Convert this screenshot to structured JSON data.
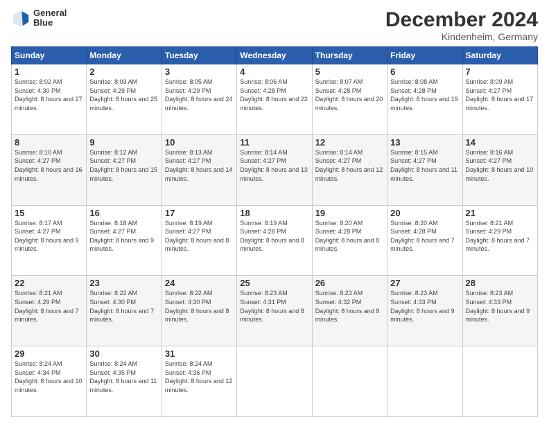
{
  "header": {
    "title": "December 2024",
    "subtitle": "Kindenheim, Germany",
    "logo_line1": "General",
    "logo_line2": "Blue"
  },
  "days_of_week": [
    "Sunday",
    "Monday",
    "Tuesday",
    "Wednesday",
    "Thursday",
    "Friday",
    "Saturday"
  ],
  "weeks": [
    [
      {
        "day": 1,
        "sunrise": "8:02 AM",
        "sunset": "4:30 PM",
        "daylight": "8 hours and 27 minutes."
      },
      {
        "day": 2,
        "sunrise": "8:03 AM",
        "sunset": "4:29 PM",
        "daylight": "8 hours and 25 minutes."
      },
      {
        "day": 3,
        "sunrise": "8:05 AM",
        "sunset": "4:29 PM",
        "daylight": "8 hours and 24 minutes."
      },
      {
        "day": 4,
        "sunrise": "8:06 AM",
        "sunset": "4:28 PM",
        "daylight": "8 hours and 22 minutes."
      },
      {
        "day": 5,
        "sunrise": "8:07 AM",
        "sunset": "4:28 PM",
        "daylight": "8 hours and 20 minutes."
      },
      {
        "day": 6,
        "sunrise": "8:08 AM",
        "sunset": "4:28 PM",
        "daylight": "8 hours and 19 minutes."
      },
      {
        "day": 7,
        "sunrise": "8:09 AM",
        "sunset": "4:27 PM",
        "daylight": "8 hours and 17 minutes."
      }
    ],
    [
      {
        "day": 8,
        "sunrise": "8:10 AM",
        "sunset": "4:27 PM",
        "daylight": "8 hours and 16 minutes."
      },
      {
        "day": 9,
        "sunrise": "8:12 AM",
        "sunset": "4:27 PM",
        "daylight": "8 hours and 15 minutes."
      },
      {
        "day": 10,
        "sunrise": "8:13 AM",
        "sunset": "4:27 PM",
        "daylight": "8 hours and 14 minutes."
      },
      {
        "day": 11,
        "sunrise": "8:14 AM",
        "sunset": "4:27 PM",
        "daylight": "8 hours and 13 minutes."
      },
      {
        "day": 12,
        "sunrise": "8:14 AM",
        "sunset": "4:27 PM",
        "daylight": "8 hours and 12 minutes."
      },
      {
        "day": 13,
        "sunrise": "8:15 AM",
        "sunset": "4:27 PM",
        "daylight": "8 hours and 11 minutes."
      },
      {
        "day": 14,
        "sunrise": "8:16 AM",
        "sunset": "4:27 PM",
        "daylight": "8 hours and 10 minutes."
      }
    ],
    [
      {
        "day": 15,
        "sunrise": "8:17 AM",
        "sunset": "4:27 PM",
        "daylight": "8 hours and 9 minutes."
      },
      {
        "day": 16,
        "sunrise": "8:18 AM",
        "sunset": "4:27 PM",
        "daylight": "8 hours and 9 minutes."
      },
      {
        "day": 17,
        "sunrise": "8:19 AM",
        "sunset": "4:27 PM",
        "daylight": "8 hours and 8 minutes."
      },
      {
        "day": 18,
        "sunrise": "8:19 AM",
        "sunset": "4:28 PM",
        "daylight": "8 hours and 8 minutes."
      },
      {
        "day": 19,
        "sunrise": "8:20 AM",
        "sunset": "4:28 PM",
        "daylight": "8 hours and 8 minutes."
      },
      {
        "day": 20,
        "sunrise": "8:20 AM",
        "sunset": "4:28 PM",
        "daylight": "8 hours and 7 minutes."
      },
      {
        "day": 21,
        "sunrise": "8:21 AM",
        "sunset": "4:29 PM",
        "daylight": "8 hours and 7 minutes."
      }
    ],
    [
      {
        "day": 22,
        "sunrise": "8:21 AM",
        "sunset": "4:29 PM",
        "daylight": "8 hours and 7 minutes."
      },
      {
        "day": 23,
        "sunrise": "8:22 AM",
        "sunset": "4:30 PM",
        "daylight": "8 hours and 7 minutes."
      },
      {
        "day": 24,
        "sunrise": "8:22 AM",
        "sunset": "4:30 PM",
        "daylight": "8 hours and 8 minutes."
      },
      {
        "day": 25,
        "sunrise": "8:23 AM",
        "sunset": "4:31 PM",
        "daylight": "8 hours and 8 minutes."
      },
      {
        "day": 26,
        "sunrise": "8:23 AM",
        "sunset": "4:32 PM",
        "daylight": "8 hours and 8 minutes."
      },
      {
        "day": 27,
        "sunrise": "8:23 AM",
        "sunset": "4:33 PM",
        "daylight": "8 hours and 9 minutes."
      },
      {
        "day": 28,
        "sunrise": "8:23 AM",
        "sunset": "4:33 PM",
        "daylight": "8 hours and 9 minutes."
      }
    ],
    [
      {
        "day": 29,
        "sunrise": "8:24 AM",
        "sunset": "4:34 PM",
        "daylight": "8 hours and 10 minutes."
      },
      {
        "day": 30,
        "sunrise": "8:24 AM",
        "sunset": "4:35 PM",
        "daylight": "8 hours and 11 minutes."
      },
      {
        "day": 31,
        "sunrise": "8:24 AM",
        "sunset": "4:36 PM",
        "daylight": "8 hours and 12 minutes."
      },
      null,
      null,
      null,
      null
    ]
  ]
}
